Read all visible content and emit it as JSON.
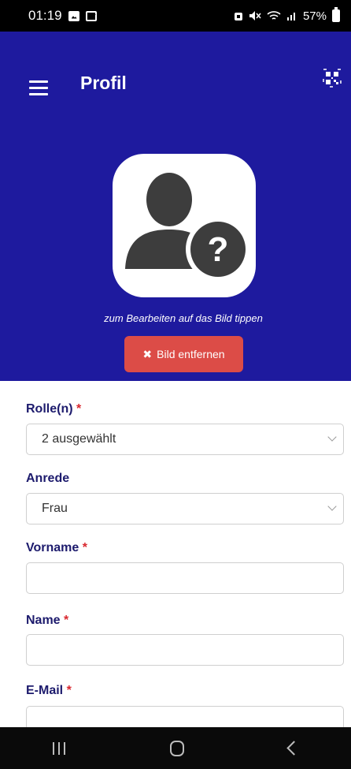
{
  "status_bar": {
    "time": "01:19",
    "battery": "57%",
    "icons": [
      "image-icon",
      "check-icon",
      "alarm-icon",
      "mute-icon",
      "wifi-icon",
      "signal-icon",
      "battery-icon"
    ]
  },
  "header": {
    "title": "Profil",
    "menu_icon": "hamburger-menu-icon",
    "qr_icon": "qr-code-icon",
    "background": "#1e1a9e"
  },
  "avatar": {
    "icon": "unknown-person-icon",
    "hint": "zum Bearbeiten auf das Bild tippen"
  },
  "remove_button": {
    "icon": "close-icon",
    "label": "Bild entfernen",
    "color": "#dc4c47"
  },
  "form": {
    "rolle": {
      "label": "Rolle(n)",
      "required": "*",
      "value": "2 ausgewählt"
    },
    "anrede": {
      "label": "Anrede",
      "value": "Frau"
    },
    "vorname": {
      "label": "Vorname",
      "required": "*",
      "value": ""
    },
    "name": {
      "label": "Name",
      "required": "*",
      "value": ""
    },
    "email": {
      "label": "E-Mail",
      "required": "*",
      "value": ""
    }
  },
  "colors": {
    "label": "#1d1b6d",
    "required": "#d9282f"
  }
}
